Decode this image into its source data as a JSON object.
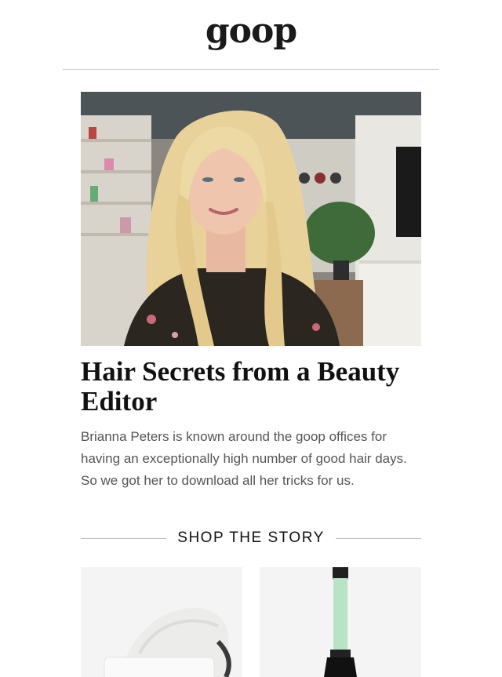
{
  "header": {
    "logo_text": "goop"
  },
  "article": {
    "title": "Hair Secrets from a Beauty Editor",
    "description": "Brianna Peters is known around the goop offices for having an exceptionally high number of good hair days. So we got her to download all her tricks for us."
  },
  "shop": {
    "heading": "SHOP THE STORY",
    "products": [
      {
        "icon": "cream-jar-icon"
      },
      {
        "icon": "curling-wand-icon"
      }
    ]
  },
  "colors": {
    "text": "#111111",
    "body_text": "#555555",
    "rule": "#cfcfcf",
    "product_bg": "#f4f4f4",
    "wand_mint": "#b8e3c4"
  }
}
